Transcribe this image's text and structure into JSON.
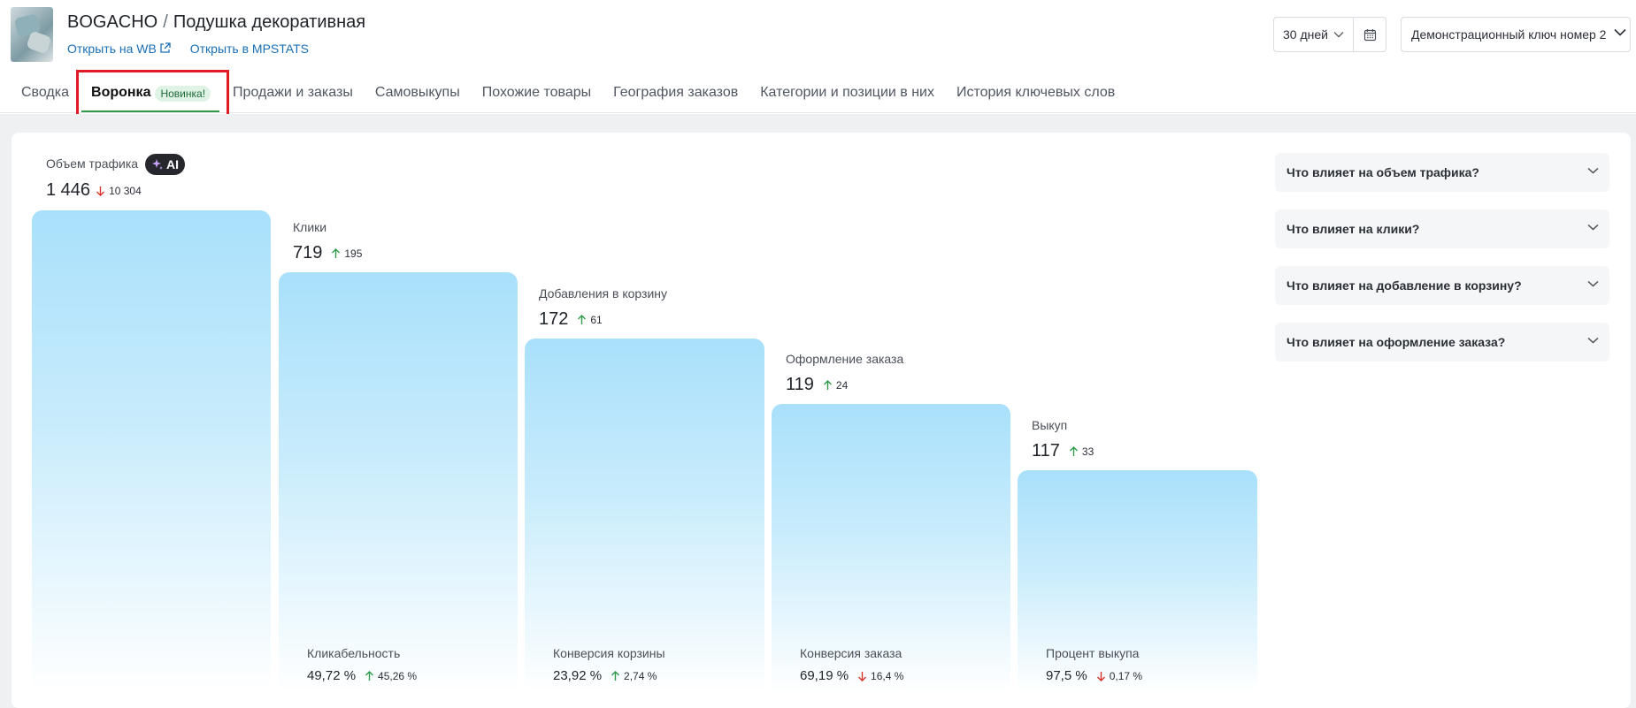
{
  "header": {
    "brand": "BOGACHO",
    "separator": "/",
    "product": "Подушка декоративная",
    "link_wb": "Открыть на WB",
    "link_mpstats": "Открыть в MPSTATS",
    "period": "30 дней",
    "key_select": "Демонстрационный ключ номер 2"
  },
  "tabs": [
    {
      "label": "Сводка"
    },
    {
      "label": "Воронка",
      "badge": "Новинка!",
      "active": true
    },
    {
      "label": "Продажи и заказы"
    },
    {
      "label": "Самовыкупы"
    },
    {
      "label": "Похожие товары"
    },
    {
      "label": "География заказов"
    },
    {
      "label": "Категории и позиции в них"
    },
    {
      "label": "История ключевых слов"
    }
  ],
  "funnel": {
    "ai_label": "AI",
    "stages": [
      {
        "label": "Объем трафика",
        "value": "1 446",
        "delta": "10 304",
        "delta_dir": "down"
      },
      {
        "label": "Клики",
        "value": "719",
        "delta": "195",
        "delta_dir": "up"
      },
      {
        "label": "Добавления в корзину",
        "value": "172",
        "delta": "61",
        "delta_dir": "up"
      },
      {
        "label": "Оформление заказа",
        "value": "119",
        "delta": "24",
        "delta_dir": "up"
      },
      {
        "label": "Выкуп",
        "value": "117",
        "delta": "33",
        "delta_dir": "up"
      }
    ],
    "conversions": [
      {
        "label": "Кликабельность",
        "value": "49,72 %",
        "delta": "45,26 %",
        "delta_dir": "up"
      },
      {
        "label": "Конверсия корзины",
        "value": "23,92 %",
        "delta": "2,74 %",
        "delta_dir": "up"
      },
      {
        "label": "Конверсия заказа",
        "value": "69,19 %",
        "delta": "16,4 %",
        "delta_dir": "down"
      },
      {
        "label": "Процент выкупа",
        "value": "97,5 %",
        "delta": "0,17 %",
        "delta_dir": "down"
      }
    ]
  },
  "accordion": [
    {
      "label": "Что влияет на объем трафика?"
    },
    {
      "label": "Что влияет на клики?"
    },
    {
      "label": "Что влияет на добавление в корзину?"
    },
    {
      "label": "Что влияет на оформление заказа?"
    }
  ],
  "colors": {
    "up": "#2e9a4a",
    "down": "#d9342b",
    "link": "#1a6fb5",
    "tab_active_underline": "#2e9a4a",
    "highlight_box": "#e01b24"
  }
}
